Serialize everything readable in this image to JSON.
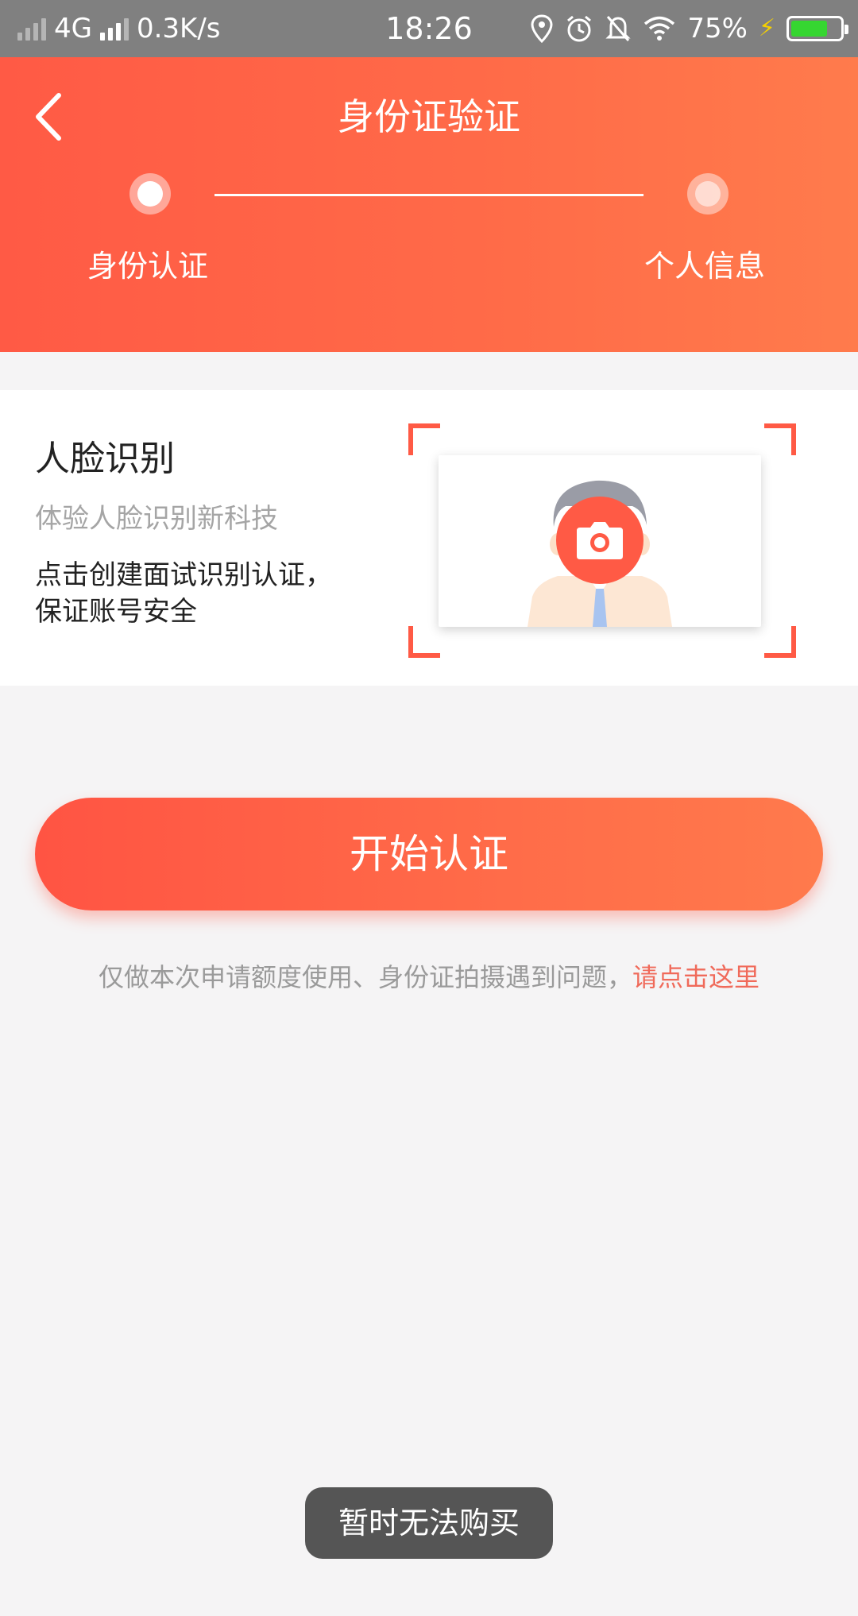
{
  "status_bar": {
    "network": "4G",
    "speed": "0.3K/s",
    "time": "18:26",
    "battery": "75%",
    "icons": [
      "signal-icon",
      "location-icon",
      "alarm-icon",
      "mute-icon",
      "wifi-icon",
      "battery-icon"
    ]
  },
  "header": {
    "title": "身份证验证",
    "steps": [
      {
        "label": "身份认证",
        "active": true
      },
      {
        "label": "个人信息",
        "active": false
      }
    ]
  },
  "face_card": {
    "title": "人脸识别",
    "subtitle": "体验人脸识别新科技",
    "desc_line1": "点击创建面试识别认证，",
    "desc_line2": "保证账号安全"
  },
  "start_button": {
    "label": "开始认证"
  },
  "notice": {
    "text": "仅做本次申请额度使用、身份证拍摄遇到问题，",
    "link": "请点击这里"
  },
  "toast": {
    "text": "暂时无法购买"
  },
  "colors": {
    "accent": "#ff5a45",
    "accent_end": "#ff7b4c",
    "link": "#f06a5a",
    "background": "#f5f4f5"
  }
}
